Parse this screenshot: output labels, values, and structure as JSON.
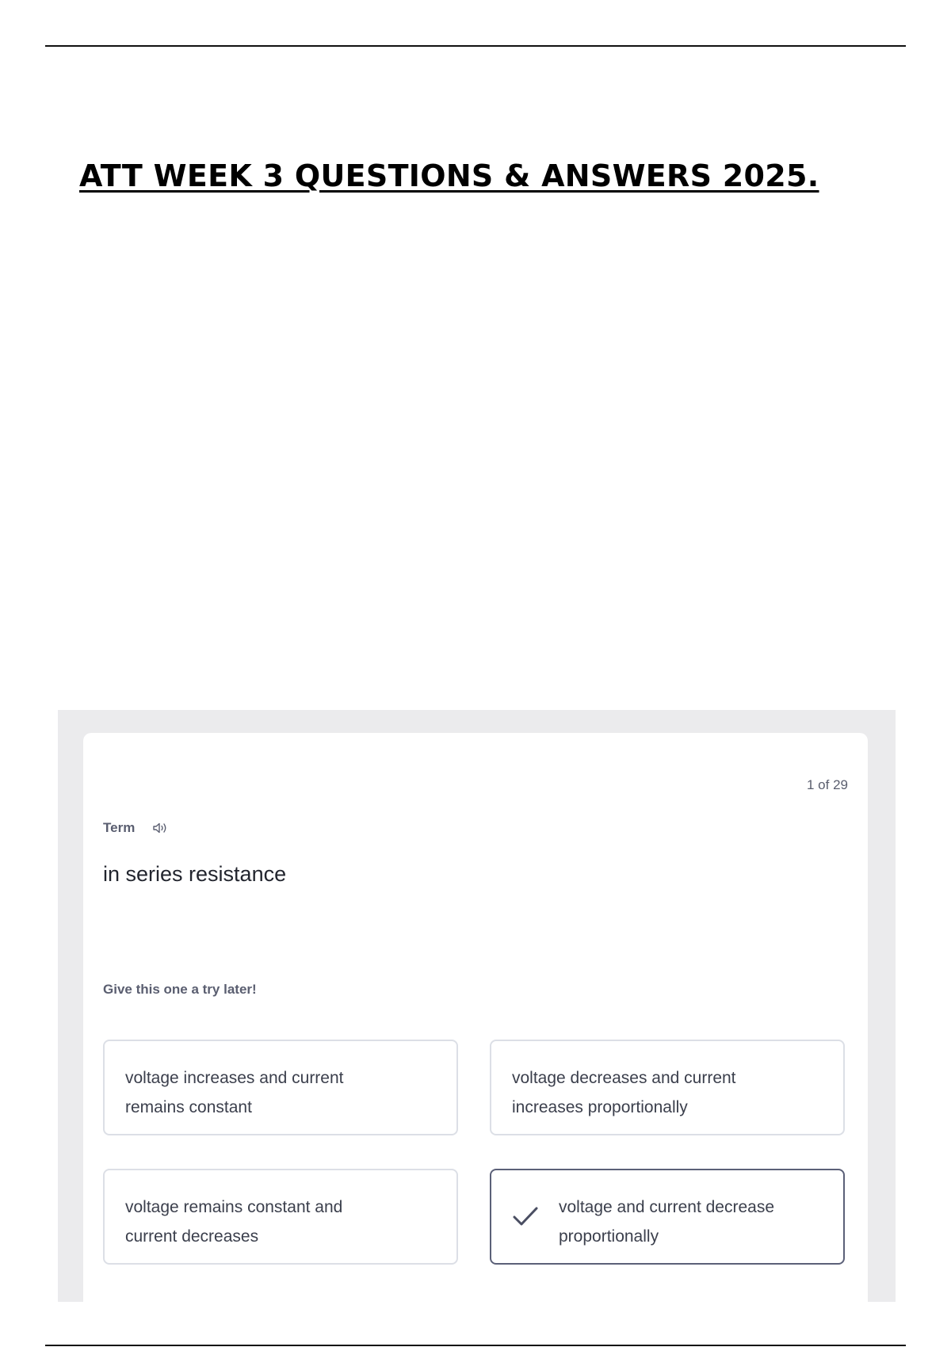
{
  "document": {
    "title": "ATT WEEK 3 QUESTIONS & ANSWERS 2025."
  },
  "card": {
    "counter": "1 of 29",
    "term_label": "Term",
    "speaker_icon": "speaker-icon",
    "prompt": "in series resistance",
    "hint": "Give this one a try later!",
    "options": [
      {
        "text": "voltage increases and current remains constant",
        "selected": false
      },
      {
        "text": "voltage decreases and current increases proportionally",
        "selected": false
      },
      {
        "text": "voltage remains constant and current decreases",
        "selected": false
      },
      {
        "text": "voltage and current decrease proportionally",
        "selected": true,
        "icon": "check-icon"
      }
    ]
  }
}
